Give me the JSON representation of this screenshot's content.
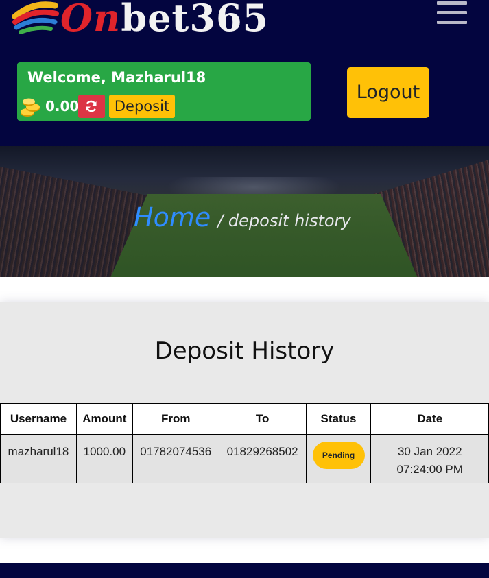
{
  "brand": {
    "logo_prefix": "On",
    "logo_suffix": "bet365"
  },
  "user_box": {
    "welcome": "Welcome, Mazharul18",
    "balance": "0.00",
    "deposit_label": "Deposit",
    "icons": [
      "coins-icon",
      "refresh-icon"
    ]
  },
  "logout_label": "Logout",
  "banner": {
    "home_label": "Home",
    "current": "/ deposit history"
  },
  "history": {
    "title": "Deposit History",
    "columns": [
      "Username",
      "Amount",
      "From",
      "To",
      "Status",
      "Date"
    ],
    "rows": [
      {
        "username": "mazharul18",
        "amount": "1000.00",
        "from": "01782074536",
        "to": "01829268502",
        "status": "Pending",
        "date_line1": "30 Jan 2022",
        "date_line2": "07:24:00 PM"
      }
    ]
  },
  "colors": {
    "header_bg": "#03053f",
    "welcome_bg": "#28a745",
    "button_yellow": "#ffc107",
    "refresh_red": "#dc3545",
    "home_link": "#2f8cff"
  }
}
